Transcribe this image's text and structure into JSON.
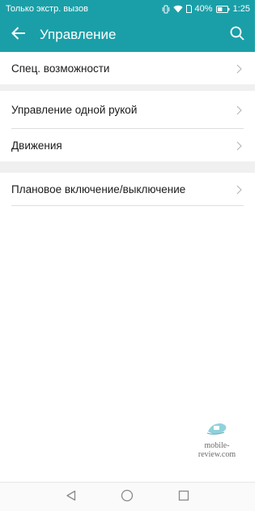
{
  "status_bar": {
    "carrier_text": "Только экстр. вызов",
    "battery_percent": "40%",
    "time": "1:25",
    "icons": [
      "vibrate-icon",
      "wifi-icon",
      "sim-icon",
      "battery-icon"
    ]
  },
  "app_bar": {
    "title": "Управление",
    "back_icon": "arrow-left-icon",
    "search_icon": "search-icon",
    "background_color": "#1a9fa8"
  },
  "settings": {
    "sections": [
      {
        "items": [
          {
            "label": "Спец. возможности"
          }
        ]
      },
      {
        "items": [
          {
            "label": "Управление одной рукой"
          },
          {
            "label": "Движения"
          }
        ]
      },
      {
        "items": [
          {
            "label": "Плановое включение/выключение"
          }
        ]
      }
    ]
  },
  "watermark": {
    "text": "mobile-review.com"
  },
  "nav_bar": {
    "buttons": [
      "back-triangle-icon",
      "home-circle-icon",
      "recents-square-icon"
    ]
  }
}
